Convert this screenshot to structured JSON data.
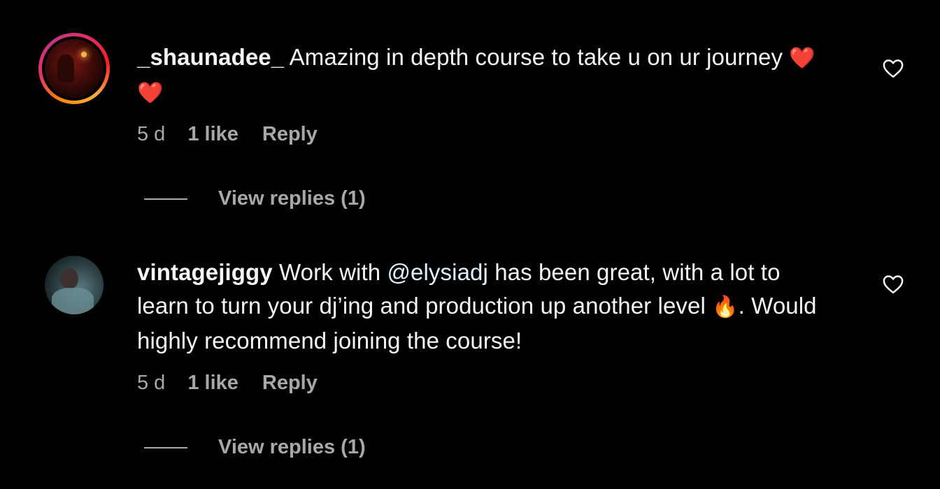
{
  "comments": [
    {
      "username": "_shaunadee_",
      "text_parts": [
        "Amazing in depth course to take u on ur journey "
      ],
      "emoji": "❤️❤️",
      "time": "5 d",
      "likes": "1 like",
      "reply_label": "Reply",
      "view_replies": "View replies (1)"
    },
    {
      "username": "vintagejiggy",
      "text_before_mention": "Work with ",
      "mention": "@elysiadj",
      "text_after_mention": " has been great, with a lot to learn to turn your dj’ing and production up another level ",
      "emoji": "🔥",
      "text_after_emoji": ". Would highly recommend joining the course!",
      "time": "5 d",
      "likes": "1 like",
      "reply_label": "Reply",
      "view_replies": "View replies (1)"
    }
  ],
  "colors": {
    "background": "#000000",
    "primary_text": "#f5f5f5",
    "secondary_text": "#a8a8a8",
    "mention": "#e0f1ff",
    "story_ring": [
      "#fcaf45",
      "#e1306c",
      "#c13584"
    ]
  },
  "icons": {
    "like": "heart-outline-icon"
  }
}
